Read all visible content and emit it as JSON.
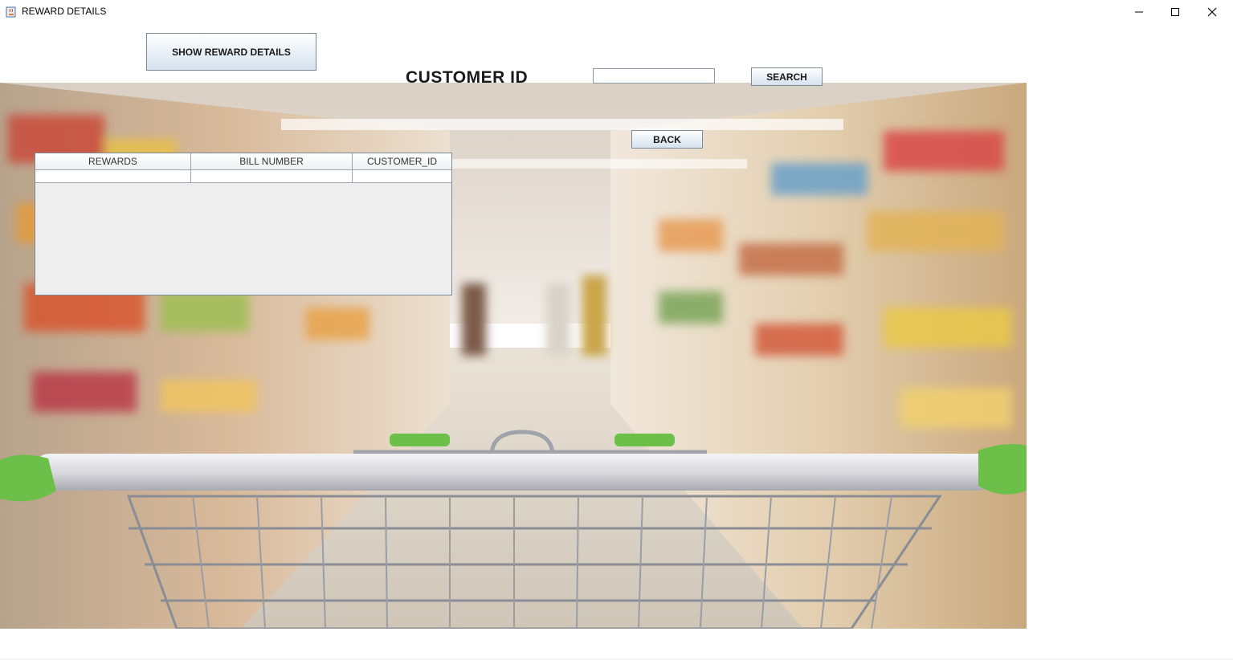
{
  "window": {
    "title": "REWARD DETAILS",
    "icon": "java-cup-icon",
    "controls": [
      "minimize-icon",
      "maximize-icon",
      "close-icon"
    ]
  },
  "toolbar": {
    "show_label": "SHOW REWARD DETAILS",
    "search_label": "SEARCH",
    "back_label": "BACK"
  },
  "search": {
    "label": "CUSTOMER ID",
    "value": "",
    "placeholder": ""
  },
  "table": {
    "columns": [
      "REWARDS",
      "BILL NUMBER",
      "CUSTOMER_ID"
    ],
    "rows": [
      [
        "",
        "",
        ""
      ]
    ]
  },
  "background": {
    "depicts": "supermarket aisle with shopping cart",
    "cart_accent": "#6cc04a"
  }
}
